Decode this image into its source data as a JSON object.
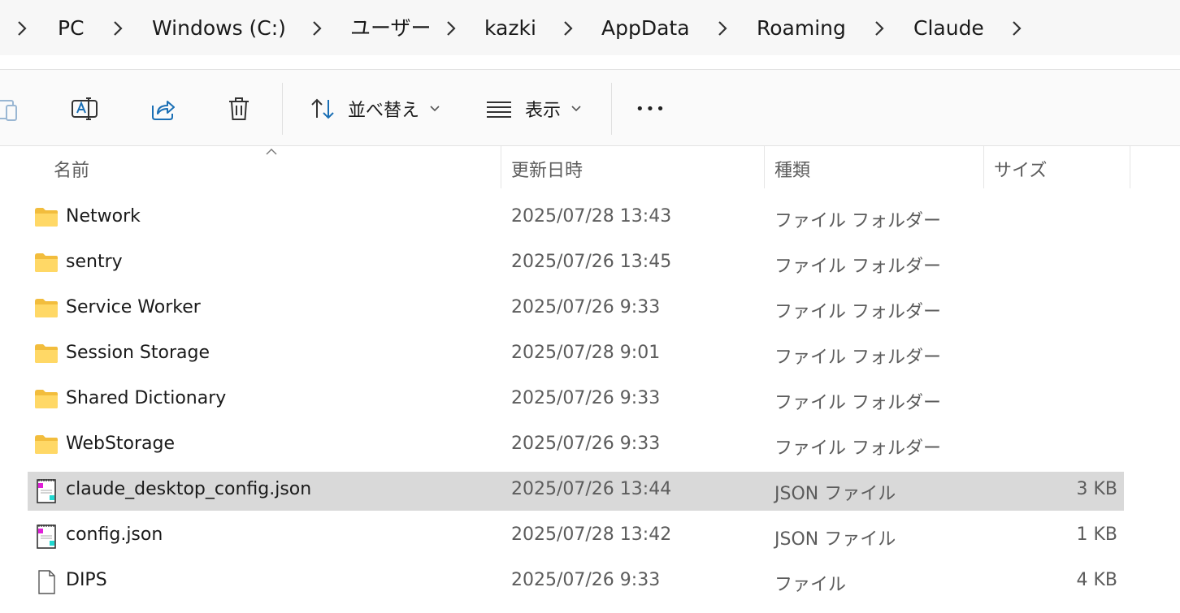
{
  "breadcrumb": [
    "PC",
    "Windows (C:)",
    "ユーザー",
    "kazki",
    "AppData",
    "Roaming",
    "Claude"
  ],
  "toolbar": {
    "sort_label": "並べ替え",
    "view_label": "表示",
    "more_label": "•••"
  },
  "columns": {
    "name": "名前",
    "date": "更新日時",
    "type": "種類",
    "size": "サイズ"
  },
  "files": [
    {
      "name": "Network",
      "date": "2025/07/28 13:43",
      "type": "ファイル フォルダー",
      "size": "",
      "icon": "folder-icon"
    },
    {
      "name": "sentry",
      "date": "2025/07/26 13:45",
      "type": "ファイル フォルダー",
      "size": "",
      "icon": "folder-icon"
    },
    {
      "name": "Service Worker",
      "date": "2025/07/26 9:33",
      "type": "ファイル フォルダー",
      "size": "",
      "icon": "folder-icon"
    },
    {
      "name": "Session Storage",
      "date": "2025/07/28 9:01",
      "type": "ファイル フォルダー",
      "size": "",
      "icon": "folder-icon"
    },
    {
      "name": "Shared Dictionary",
      "date": "2025/07/26 9:33",
      "type": "ファイル フォルダー",
      "size": "",
      "icon": "folder-icon"
    },
    {
      "name": "WebStorage",
      "date": "2025/07/26 9:33",
      "type": "ファイル フォルダー",
      "size": "",
      "icon": "folder-icon"
    },
    {
      "name": "claude_desktop_config.json",
      "date": "2025/07/26 13:44",
      "type": "JSON ファイル",
      "size": "3 KB",
      "icon": "json-file-icon",
      "selected": true
    },
    {
      "name": "config.json",
      "date": "2025/07/28 13:42",
      "type": "JSON ファイル",
      "size": "1 KB",
      "icon": "json-file-icon"
    },
    {
      "name": "DIPS",
      "date": "2025/07/26 9:33",
      "type": "ファイル",
      "size": "4 KB",
      "icon": "file-icon"
    }
  ],
  "colors": {
    "selection": "#d9d9d9",
    "folder": "#f4c54a",
    "accent": "#1a6fb5"
  }
}
